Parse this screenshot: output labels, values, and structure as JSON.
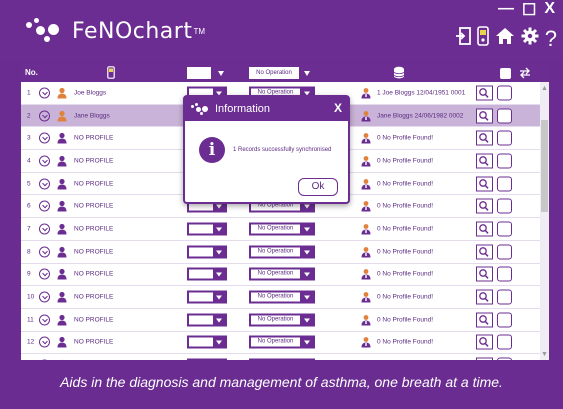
{
  "app": {
    "title": "FeNOchart",
    "trademark": "TM"
  },
  "window_controls": {
    "minimize": "—",
    "maximize": "☐",
    "close": "X"
  },
  "toolbar_icons": [
    "exit-icon",
    "device-icon",
    "home-icon",
    "gear-icon",
    "help-icon"
  ],
  "help_glyph": "?",
  "table": {
    "header_no": "No.",
    "rows": [
      {
        "num": "1",
        "name": "Joe Bloggs",
        "operation": "No Operation",
        "result": "1 Joe Bloggs 12/04/1951 0001",
        "profile_color": "#e0823c",
        "selected": false
      },
      {
        "num": "2",
        "name": "Jane Bloggs",
        "operation": "No Operation",
        "result": "Jane Bloggs 24/06/1982 0002",
        "profile_color": "#e0823c",
        "selected": true
      },
      {
        "num": "3",
        "name": "NO PROFILE",
        "operation": "No Operation",
        "result": "0 No Profile Found!",
        "profile_color": "#6b2d92",
        "selected": false
      },
      {
        "num": "4",
        "name": "NO PROFILE",
        "operation": "No Operation",
        "result": "0 No Profile Found!",
        "profile_color": "#6b2d92",
        "selected": false
      },
      {
        "num": "5",
        "name": "NO PROFILE",
        "operation": "No Operation",
        "result": "0 No Profile Found!",
        "profile_color": "#6b2d92",
        "selected": false
      },
      {
        "num": "6",
        "name": "NO PROFILE",
        "operation": "No Operation",
        "result": "0 No Profile Found!",
        "profile_color": "#6b2d92",
        "selected": false
      },
      {
        "num": "7",
        "name": "NO PROFILE",
        "operation": "No Operation",
        "result": "0 No Profile Found!",
        "profile_color": "#6b2d92",
        "selected": false
      },
      {
        "num": "8",
        "name": "NO PROFILE",
        "operation": "No Operation",
        "result": "0 No Profile Found!",
        "profile_color": "#6b2d92",
        "selected": false
      },
      {
        "num": "9",
        "name": "NO PROFILE",
        "operation": "No Operation",
        "result": "0 No Profile Found!",
        "profile_color": "#6b2d92",
        "selected": false
      },
      {
        "num": "10",
        "name": "NO PROFILE",
        "operation": "No Operation",
        "result": "0 No Profile Found!",
        "profile_color": "#6b2d92",
        "selected": false
      },
      {
        "num": "11",
        "name": "NO PROFILE",
        "operation": "No Operation",
        "result": "0 No Profile Found!",
        "profile_color": "#6b2d92",
        "selected": false
      },
      {
        "num": "12",
        "name": "NO PROFILE",
        "operation": "No Operation",
        "result": "0 No Profile Found!",
        "profile_color": "#6b2d92",
        "selected": false
      },
      {
        "num": "13",
        "name": "NO PROFILE",
        "operation": "No Operation",
        "result": "0 No Profile Found!",
        "profile_color": "#6b2d92",
        "selected": false
      }
    ]
  },
  "dialog": {
    "title": "Information",
    "close": "X",
    "icon": "i",
    "message": "1 Records successfully synchronised",
    "ok_label": "Ok"
  },
  "footer": {
    "tagline": "Aids in the diagnosis and management of asthma, one breath at a time."
  },
  "colors": {
    "brand_purple": "#6b2d92",
    "selected_row": "#c9b3d8",
    "profile_orange": "#e0823c"
  }
}
